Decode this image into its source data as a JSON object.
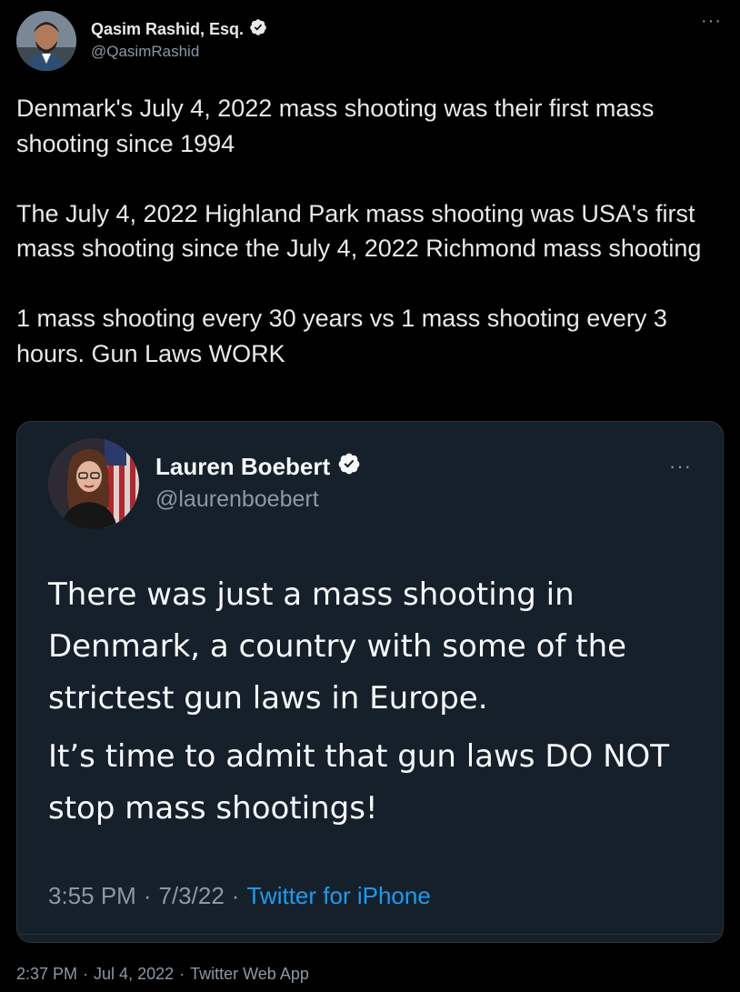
{
  "tweet": {
    "author_name": "Qasim Rashid, Esq.",
    "author_handle": "@QasimRashid",
    "more_label": "···",
    "paragraphs": [
      "Denmark's July 4, 2022 mass shooting was their first mass shooting since 1994",
      "The July 4, 2022 Highland Park mass shooting was USA's first mass shooting since the July 4, 2022 Richmond mass shooting",
      "1 mass shooting every 30 years vs 1 mass shooting every 3 hours. Gun Laws WORK"
    ],
    "time": "2:37 PM",
    "date": "Jul 4, 2022",
    "source": "Twitter Web App",
    "separator": "·"
  },
  "quote": {
    "author_name": "Lauren Boebert",
    "author_handle": "@laurenboebert",
    "more_label": "···",
    "paragraphs": [
      "There was just a mass shooting in Denmark, a country with some of the strictest gun laws in Europe.",
      "It’s time to admit that gun laws DO NOT stop mass shootings!"
    ],
    "time": "3:55 PM",
    "date": "7/3/22",
    "source": "Twitter for iPhone",
    "separator": "·"
  },
  "colors": {
    "background": "#000000",
    "card_background": "#15202b",
    "text_primary": "#e7e9ea",
    "text_secondary": "#8b98a5",
    "link": "#1d9bf0"
  },
  "icons": {
    "verified": "verified-badge-icon",
    "more": "more-options-icon"
  }
}
